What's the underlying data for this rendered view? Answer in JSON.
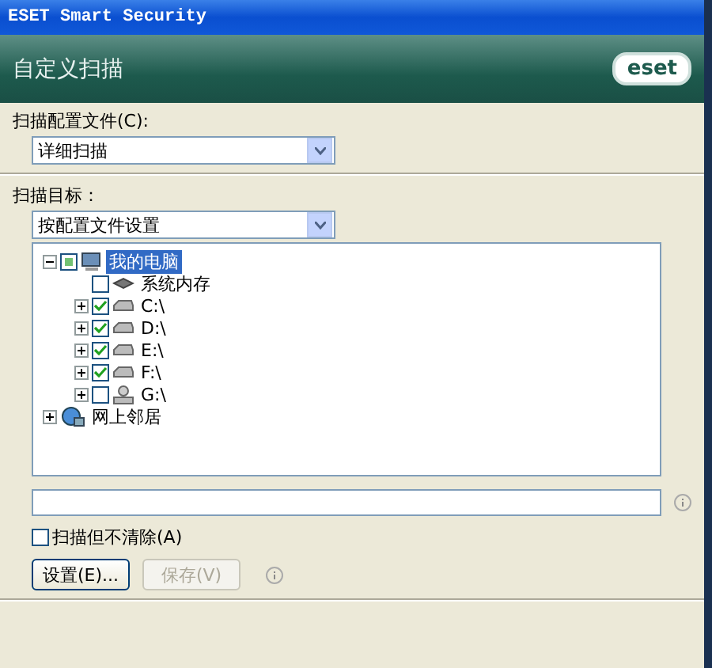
{
  "window": {
    "title": "ESET Smart Security"
  },
  "header": {
    "title": "自定义扫描",
    "logo": "eset"
  },
  "profile": {
    "label": "扫描配置文件(C):",
    "value": "详细扫描"
  },
  "targets": {
    "label": "扫描目标：",
    "value": "按配置文件设置"
  },
  "tree": [
    {
      "label": "我的电脑",
      "kind": "computer",
      "partial": true,
      "selected": true,
      "expanded": true,
      "children": [
        {
          "label": "系统内存",
          "kind": "memory",
          "checked": false,
          "selected": false
        },
        {
          "label": "C:\\",
          "kind": "drive",
          "checked": true,
          "selected": false,
          "expanded": false
        },
        {
          "label": "D:\\",
          "kind": "drive",
          "checked": true,
          "selected": false,
          "expanded": false
        },
        {
          "label": "E:\\",
          "kind": "drive",
          "checked": true,
          "selected": false,
          "expanded": false
        },
        {
          "label": "F:\\",
          "kind": "drive",
          "checked": true,
          "selected": false,
          "expanded": false
        },
        {
          "label": "G:\\",
          "kind": "user",
          "checked": false,
          "selected": false,
          "expanded": false
        }
      ]
    },
    {
      "label": "网上邻居",
      "kind": "network",
      "selected": false,
      "expanded": false
    }
  ],
  "no_clean": {
    "label": "扫描但不清除(A)",
    "checked": false
  },
  "buttons": [
    {
      "label": "设置(E)...",
      "disabled": false
    },
    {
      "label": "保存(V)",
      "disabled": true
    }
  ]
}
